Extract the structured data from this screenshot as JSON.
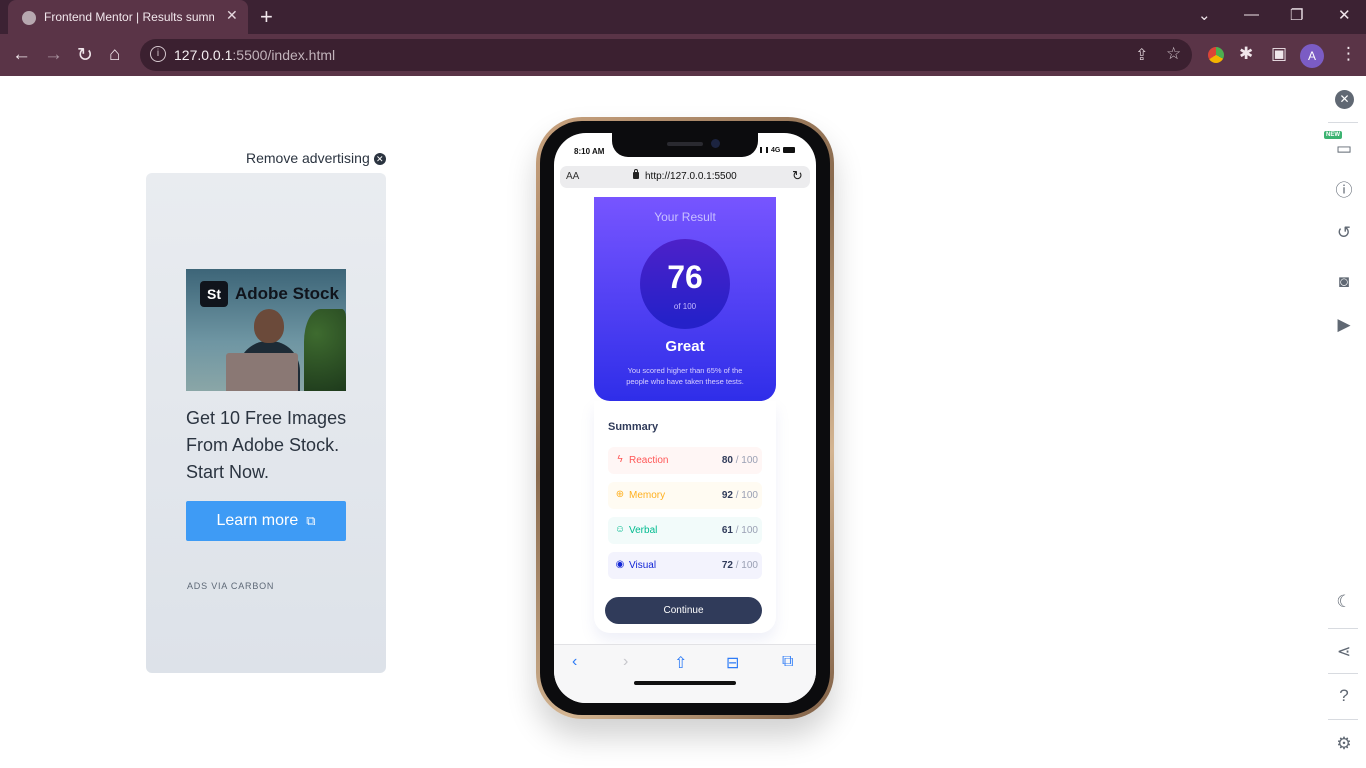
{
  "browser": {
    "tab_title": "Frontend Mentor | Results summ",
    "url_host": "127.0.0.1",
    "url_rest": ":5500/index.html",
    "profile_initial": "A"
  },
  "ad": {
    "remove_label": "Remove advertising",
    "brand_logo": "St",
    "brand_name": "Adobe Stock",
    "text": "Get 10 Free Images From Adobe Stock. Start Now.",
    "button_label": "Learn more",
    "via": "ADS VIA CARBON"
  },
  "phone": {
    "status_time": "8:10 AM",
    "status_network": "4G",
    "address_aa": "AA",
    "address_url": "http://127.0.0.1:5500"
  },
  "result": {
    "heading": "Your Result",
    "score": "76",
    "out_of": "of 100",
    "rating": "Great",
    "description": "You scored higher than 65% of the people who have taken these tests."
  },
  "summary": {
    "title": "Summary",
    "categories": [
      {
        "label": "Reaction",
        "value": "80",
        "max": " / 100",
        "icon": "lightning-icon",
        "color": "#ff5757"
      },
      {
        "label": "Memory",
        "value": "92",
        "max": " / 100",
        "icon": "brain-icon",
        "color": "#ffb01f"
      },
      {
        "label": "Verbal",
        "value": "61",
        "max": " / 100",
        "icon": "chat-bubble-icon",
        "color": "#00bb8f"
      },
      {
        "label": "Visual",
        "value": "72",
        "max": " / 100",
        "icon": "eye-icon",
        "color": "#1125d6"
      }
    ],
    "continue_label": "Continue"
  },
  "colors": {
    "browser_frame": "#3c2233",
    "result_gradient_top": "#7755ff",
    "result_gradient_bottom": "#2f2ee9",
    "ad_button": "#3e9bf5",
    "continue_button": "#303b5a"
  }
}
